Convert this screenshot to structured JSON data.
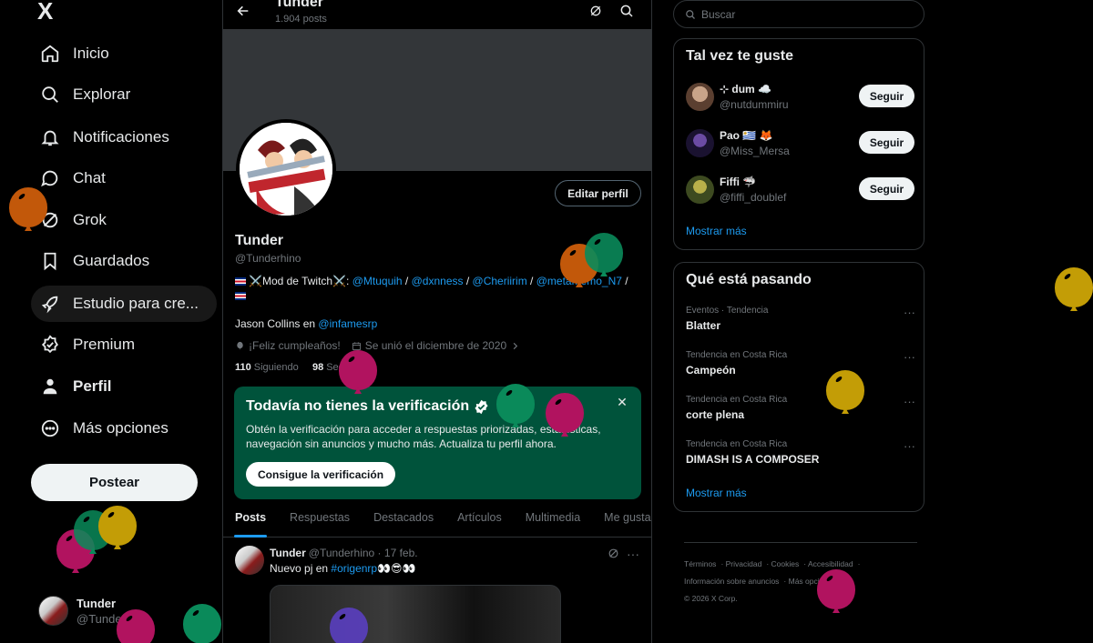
{
  "sidebar": {
    "logo": "X",
    "items": [
      {
        "label": "Inicio",
        "icon": "home-icon"
      },
      {
        "label": "Explorar",
        "icon": "search-icon"
      },
      {
        "label": "Notificaciones",
        "icon": "bell-icon"
      },
      {
        "label": "Chat",
        "icon": "chat-icon"
      },
      {
        "label": "Grok",
        "icon": "grok-icon"
      },
      {
        "label": "Guardados",
        "icon": "bookmark-icon"
      },
      {
        "label": "Estudio para cre...",
        "icon": "rocket-icon"
      },
      {
        "label": "Premium",
        "icon": "premium-icon"
      },
      {
        "label": "Perfil",
        "icon": "person-icon"
      },
      {
        "label": "Más opciones",
        "icon": "more-circle-icon"
      }
    ],
    "post_label": "Postear",
    "account": {
      "name": "Tunder",
      "handle": "@Tunderhino"
    }
  },
  "header": {
    "title": "Tunder",
    "subtitle": "1.904 posts"
  },
  "profile": {
    "edit_label": "Editar perfil",
    "name": "Tunder",
    "handle": "@Tunderhino",
    "bio_prefix": "⚔️Mod de Twitch⚔️:",
    "bio_links": [
      "@Mtuquih",
      "@dxnness",
      "@Cheriirim",
      "@metamemo_N7"
    ],
    "bio_sep": " / ",
    "line2_prefix": "Jason Collins en",
    "line2_link": "@infamesrp",
    "birthday": "¡Feliz cumpleaños!",
    "joined": "Se unió el diciembre de 2020",
    "following_count": "110",
    "following_label": "Siguiendo",
    "followers_count": "98",
    "followers_label": "Seguidores"
  },
  "verify": {
    "title": "Todavía no tienes la verificación",
    "body": "Obtén la verificación para acceder a respuestas priorizadas, estadísticas, navegación sin anuncios y mucho más. Actualiza tu perfil ahora.",
    "button": "Consigue la verificación",
    "close": "✕"
  },
  "tabs": [
    "Posts",
    "Respuestas",
    "Destacados",
    "Artículos",
    "Multimedia",
    "Me gusta"
  ],
  "post": {
    "name": "Tunder",
    "meta": "@Tunderhino · 17 feb.",
    "text_prefix": "Nuevo pj en",
    "hashtag": "#origenrp",
    "text_suffix": "👀😎👀"
  },
  "search": {
    "placeholder": "Buscar"
  },
  "suggestions": {
    "title": "Tal vez te guste",
    "items": [
      {
        "name": "⊹ dum ☁️",
        "handle": "@nutdummiru",
        "button": "Seguir"
      },
      {
        "name": "Pao 🇺🇾 🦊",
        "handle": "@Miss_Mersa",
        "button": "Seguir"
      },
      {
        "name": "Fiffi 🦈",
        "handle": "@fiffi_doublef",
        "button": "Seguir"
      }
    ],
    "show_more": "Mostrar más"
  },
  "trends": {
    "title": "Qué está pasando",
    "items": [
      {
        "category": "Eventos · Tendencia",
        "name": "Blatter"
      },
      {
        "category": "Tendencia en Costa Rica",
        "name": "Campeón"
      },
      {
        "category": "Tendencia en Costa Rica",
        "name": "corte plena"
      },
      {
        "category": "Tendencia en Costa Rica",
        "name": "DIMASH IS A COMPOSER"
      }
    ],
    "show_more": "Mostrar más"
  },
  "footer": {
    "links": [
      "Términos",
      "Privacidad",
      "Cookies",
      "Accesibilidad",
      "Información sobre anuncios",
      "Más opciones ..."
    ],
    "copyright": "© 2026 X Corp."
  },
  "colors": {
    "accent": "#1d9bf0",
    "verify_bg": "#00533b",
    "background": "#000000"
  }
}
